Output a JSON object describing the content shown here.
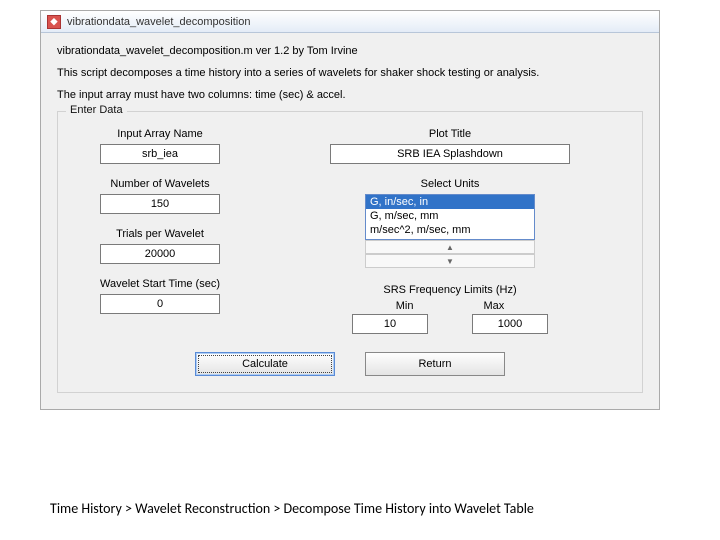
{
  "window": {
    "title": "vibrationdata_wavelet_decomposition",
    "app_icon_glyph": "◆"
  },
  "intro": {
    "line1": "vibrationdata_wavelet_decomposition.m  ver 1.2  by Tom Irvine",
    "line2": "This script decomposes a time history into a series of wavelets for shaker shock testing or analysis.",
    "line3": "The input array must have two columns:  time (sec)  &  accel."
  },
  "fieldset": {
    "legend": "Enter Data"
  },
  "left": {
    "array_label": "Input Array Name",
    "array_value": "srb_iea",
    "num_label": "Number of Wavelets",
    "num_value": "150",
    "trials_label": "Trials per Wavelet",
    "trials_value": "20000",
    "start_label": "Wavelet Start Time (sec)",
    "start_value": "0"
  },
  "right": {
    "plot_label": "Plot Title",
    "plot_value": "SRB IEA Splashdown",
    "units_label": "Select Units",
    "units_options": [
      "G, in/sec, in",
      "G, m/sec, mm",
      "m/sec^2, m/sec, mm"
    ],
    "units_selected_index": 0,
    "srs_label": "SRS Frequency Limits (Hz)",
    "min_label": "Min",
    "max_label": "Max",
    "min_value": "10",
    "max_value": "1000"
  },
  "buttons": {
    "calculate": "Calculate",
    "return": "Return"
  },
  "caption": "Time History >  Wavelet Reconstruction > Decompose Time History into Wavelet Table"
}
